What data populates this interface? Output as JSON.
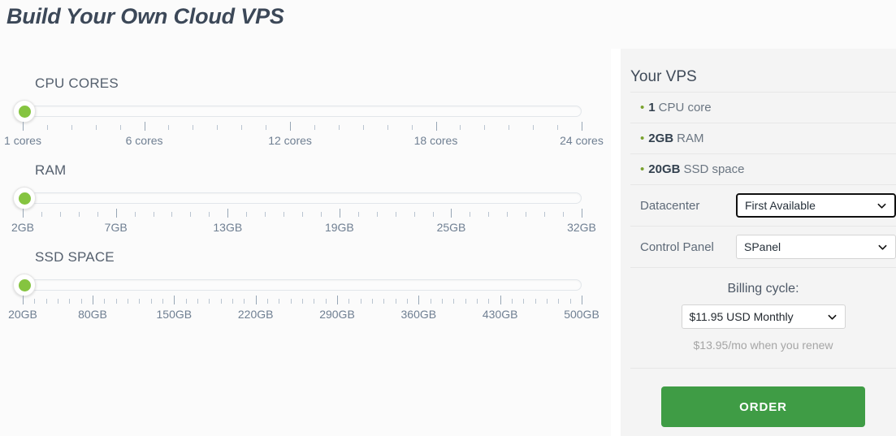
{
  "page": {
    "title": "Build Your Own Cloud VPS",
    "background": "#fbfbfb",
    "accent_green": "#3f9c45",
    "handle_green": "#85c440",
    "bullet_green": "#7aa22e"
  },
  "sliders": [
    {
      "label": "CPU CORES",
      "min": 1,
      "max": 24,
      "value": 1,
      "unit": "cores",
      "tick_count": 24,
      "tick_labels": [
        "1 cores",
        "6 cores",
        "12 cores",
        "18 cores",
        "24 cores"
      ],
      "tick_label_positions": [
        0,
        21.74,
        47.83,
        73.91,
        100
      ]
    },
    {
      "label": "RAM",
      "min": 2,
      "max": 32,
      "value": 2,
      "unit": "GB",
      "tick_count": 31,
      "tick_labels": [
        "2GB",
        "7GB",
        "13GB",
        "19GB",
        "25GB",
        "32GB"
      ],
      "tick_label_positions": [
        0,
        16.67,
        36.67,
        56.67,
        76.67,
        100
      ]
    },
    {
      "label": "SSD SPACE",
      "min": 20,
      "max": 500,
      "value": 20,
      "unit": "GB",
      "tick_count": 49,
      "tick_labels": [
        "20GB",
        "80GB",
        "150GB",
        "220GB",
        "290GB",
        "360GB",
        "430GB",
        "500GB"
      ],
      "tick_label_positions": [
        0,
        12.5,
        27.08,
        41.67,
        56.25,
        70.83,
        85.42,
        100
      ]
    }
  ],
  "summary": {
    "title": "Your VPS",
    "specs": [
      {
        "bullet": "•",
        "value": "1",
        "label": "CPU core"
      },
      {
        "bullet": "•",
        "value": "2GB",
        "label": "RAM"
      },
      {
        "bullet": "•",
        "value": "20GB",
        "label": "SSD space"
      }
    ],
    "options": [
      {
        "label": "Datacenter",
        "selected": "First Available",
        "focused": true,
        "caret_icon": "chevron-down-icon"
      },
      {
        "label": "Control Panel",
        "selected": "SPanel",
        "focused": false,
        "caret_icon": "chevron-down-icon"
      }
    ],
    "billing": {
      "title": "Billing cycle:",
      "selected": "$11.95 USD Monthly",
      "renew_note": "$13.95/mo when you renew",
      "caret_icon": "chevron-down-icon"
    },
    "order_button": "ORDER"
  }
}
